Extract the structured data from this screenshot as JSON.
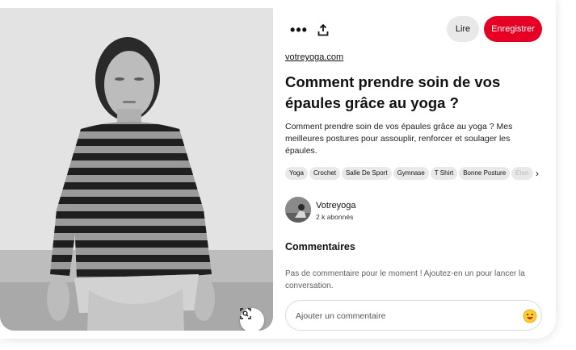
{
  "toolbar": {
    "more_glyph": "•••",
    "read_label": "Lire",
    "save_label": "Enregistrer"
  },
  "pin": {
    "source": "votreyoga.com",
    "title": "Comment prendre soin de vos épaules grâce au yoga ?",
    "description": "Comment prendre soin de vos épaules grâce au yoga ? Mes meilleures postures pour assouplir, renforcer et soulager les épaules.",
    "tags": [
      "Yoga",
      "Crochet",
      "Salle De Sport",
      "Gymnase",
      "T Shirt",
      "Bonne Posture",
      "Éten"
    ],
    "tags_arrow": "›"
  },
  "author": {
    "name": "Votreyoga",
    "followers": "2 k abonnés"
  },
  "comments": {
    "title": "Commentaires",
    "empty_text": "Pas de commentaire pour le moment ! Ajoutez-en un pour lancer la conversation.",
    "input_placeholder": "Ajouter un commentaire"
  },
  "icons": {
    "more": "more-icon",
    "share": "share-icon",
    "lens": "visual-search-icon",
    "emoji": "emoji-icon",
    "chevron": "chevron-right-icon"
  },
  "colors": {
    "brand_red": "#e60023",
    "chip_gray": "#e9e9e9",
    "text": "#111111"
  }
}
